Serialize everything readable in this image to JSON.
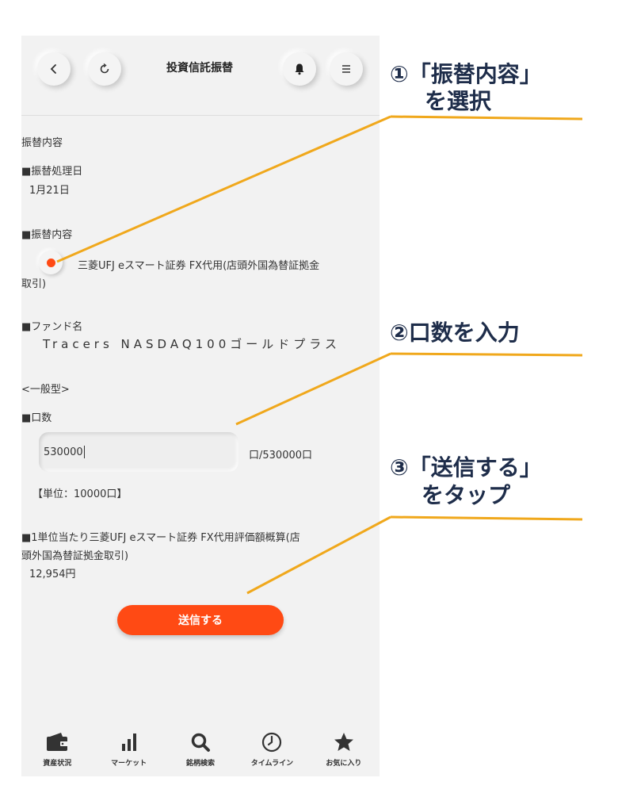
{
  "header": {
    "title": "投資信託振替",
    "back_icon": "chevron-left-icon",
    "refresh_icon": "refresh-icon",
    "bell_icon": "bell-icon",
    "menu_icon": "menu-icon"
  },
  "form": {
    "section_title": "振替内容",
    "date_label": "■振替処理日",
    "date_value": "1月21日",
    "content_label": "■振替内容",
    "option_line1": "三菱UFJ eスマート証券 FX代用(店頭外国為替証拠金",
    "option_line2": "取引)",
    "fund_label": "■ファンド名",
    "fund_name": "Tracers NASDAQ100ゴールドプラス",
    "fund_type": "<一般型>",
    "qty_label": "■口数",
    "qty_value": "530000",
    "qty_max": "口/530000口",
    "unit_note": "【単位：10000口】",
    "valuation_line1": "■1単位当たり三菱UFJ eスマート証券 FX代用評価額概算(店",
    "valuation_line2": "頭外国為替証拠金取引)",
    "valuation_value": "12,954円",
    "submit_label": "送信する"
  },
  "tabs": [
    {
      "label": "資産状況",
      "icon": "wallet-icon"
    },
    {
      "label": "マーケット",
      "icon": "bar-chart-icon"
    },
    {
      "label": "銘柄検索",
      "icon": "search-icon"
    },
    {
      "label": "タイムライン",
      "icon": "clock-icon"
    },
    {
      "label": "お気に入り",
      "icon": "star-icon"
    }
  ],
  "annotations": {
    "step1_line1": "①「振替内容」",
    "step1_line2": "を選択",
    "step2": "②口数を入力",
    "step3_line1": "③「送信する」",
    "step3_line2": "をタップ"
  },
  "colors": {
    "accent": "#ff4a14",
    "annotation_text": "#1e2d4a",
    "annotation_line": "#f0a81c",
    "background": "#f2f2f2"
  }
}
